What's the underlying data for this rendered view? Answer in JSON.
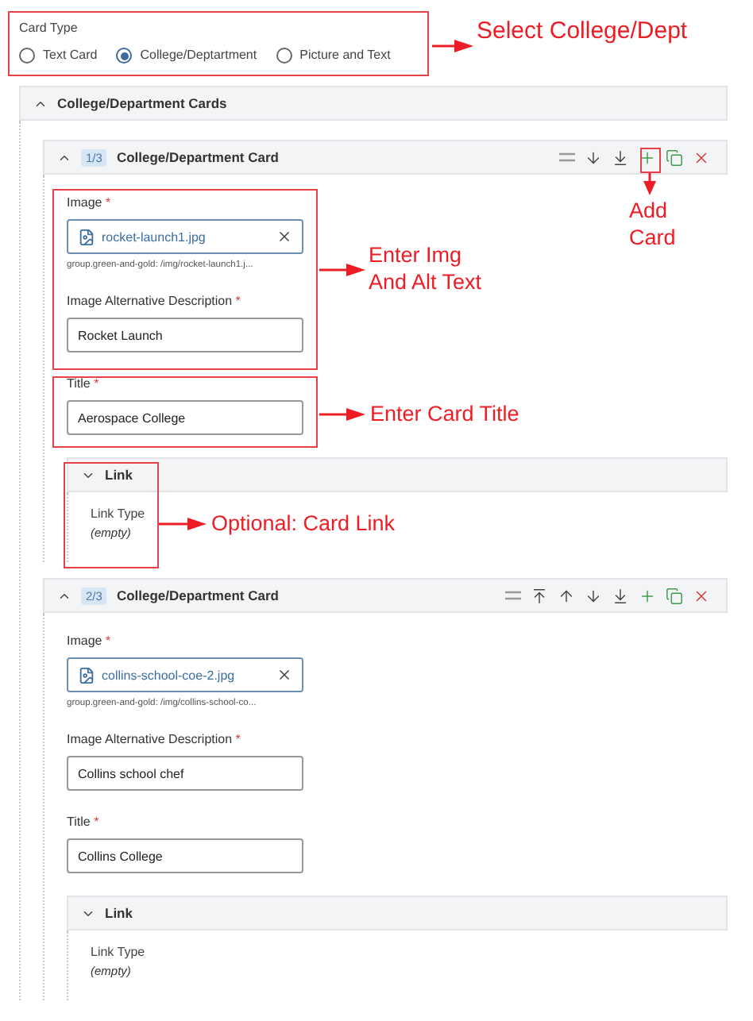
{
  "card_type": {
    "label": "Card Type",
    "options": [
      {
        "label": "Text Card",
        "selected": false
      },
      {
        "label": "College/Deptartment",
        "selected": true
      },
      {
        "label": "Picture and Text",
        "selected": false
      }
    ]
  },
  "section": {
    "title": "College/Department Cards",
    "cards": [
      {
        "index": "1/3",
        "title": "College/Department Card",
        "actions": [
          {
            "kind": "drag"
          },
          {
            "kind": "move-down"
          },
          {
            "kind": "move-bottom"
          },
          {
            "kind": "add"
          },
          {
            "kind": "copy"
          },
          {
            "kind": "delete"
          }
        ],
        "fields": [
          {
            "kind": "file",
            "label": "Image",
            "required_mark": "*",
            "value": "rocket-launch1.jpg",
            "path": "group.green-and-gold: /img/rocket-launch1.j..."
          },
          {
            "kind": "text",
            "label": "Image Alternative Description",
            "required_mark": "*",
            "value": "Rocket Launch"
          },
          {
            "kind": "text",
            "label": "Title",
            "required_mark": "*",
            "value": "Aerospace College"
          }
        ],
        "link": {
          "title": "Link",
          "field_label": "Link Type",
          "value": "(empty)"
        }
      },
      {
        "index": "2/3",
        "title": "College/Department Card",
        "actions": [
          {
            "kind": "drag"
          },
          {
            "kind": "move-top"
          },
          {
            "kind": "move-up"
          },
          {
            "kind": "move-down"
          },
          {
            "kind": "move-bottom"
          },
          {
            "kind": "add"
          },
          {
            "kind": "copy"
          },
          {
            "kind": "delete"
          }
        ],
        "fields": [
          {
            "kind": "file",
            "label": "Image",
            "required_mark": "*",
            "value": "collins-school-coe-2.jpg",
            "path": "group.green-and-gold: /img/collins-school-co..."
          },
          {
            "kind": "text",
            "label": "Image Alternative Description",
            "required_mark": "*",
            "value": "Collins school chef"
          },
          {
            "kind": "text",
            "label": "Title",
            "required_mark": "*",
            "value": "Collins College"
          }
        ],
        "link": {
          "title": "Link",
          "field_label": "Link Type",
          "value": "(empty)"
        }
      }
    ]
  },
  "annotations": [
    {
      "lines": [
        "Select College/Dept"
      ]
    },
    {
      "lines": [
        "Add",
        "Card"
      ]
    },
    {
      "lines": [
        "Enter Img",
        "And Alt Text"
      ]
    },
    {
      "lines": [
        "Enter Card Title"
      ]
    },
    {
      "lines": [
        "Optional: Card Link"
      ]
    }
  ]
}
